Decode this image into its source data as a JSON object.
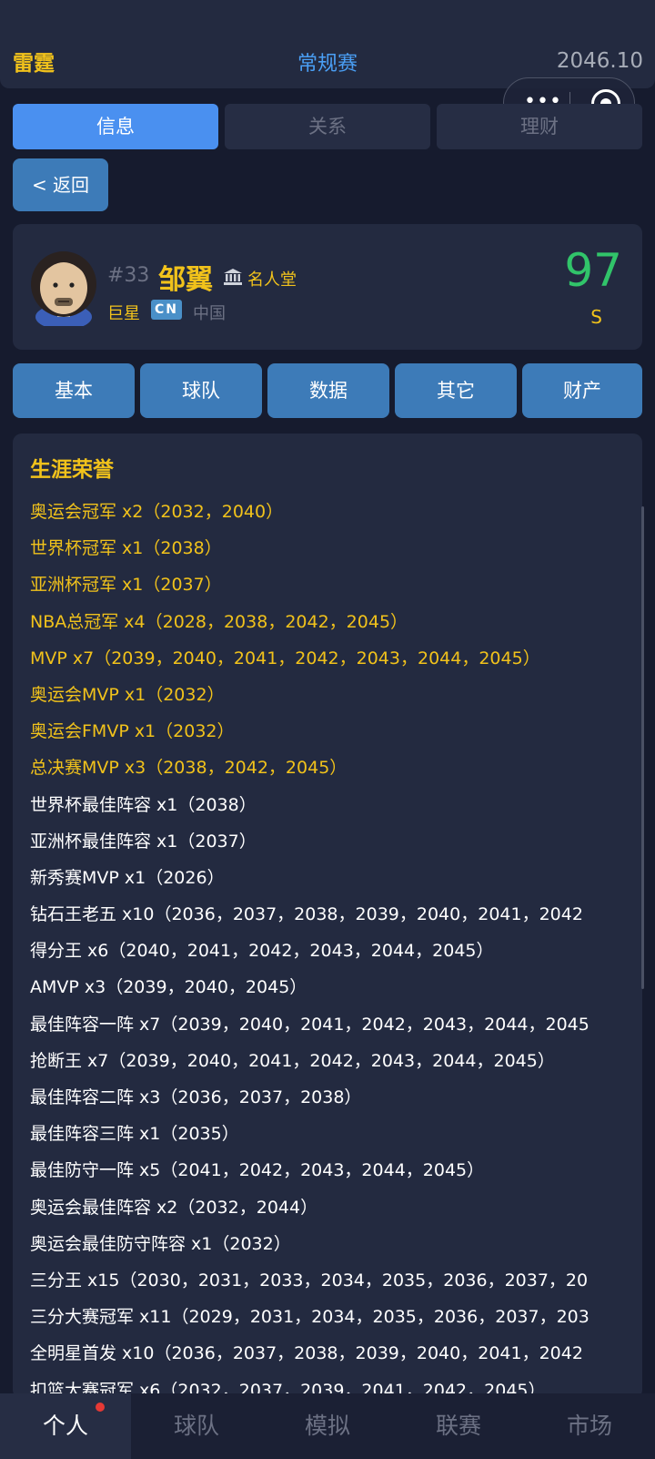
{
  "header": {
    "team": "雷霆",
    "season_type": "常规赛",
    "date": "2046.10"
  },
  "tabs": [
    {
      "label": "信息",
      "active": true
    },
    {
      "label": "关系",
      "active": false
    },
    {
      "label": "理财",
      "active": false
    }
  ],
  "back_label": "< 返回",
  "player": {
    "number": "#33",
    "name": "邹翼",
    "hall_label": "名人堂",
    "tier": "巨星",
    "flag": "CN",
    "country": "中国",
    "rating": "97",
    "grade": "S"
  },
  "subnav": [
    "基本",
    "球队",
    "数据",
    "其它",
    "财产"
  ],
  "honors": {
    "title": "生涯荣誉",
    "items": [
      {
        "text": "奥运会冠军 x2（2032，2040）",
        "gold": true
      },
      {
        "text": "世界杯冠军 x1（2038）",
        "gold": true
      },
      {
        "text": "亚洲杯冠军 x1（2037）",
        "gold": true
      },
      {
        "text": "NBA总冠军 x4（2028，2038，2042，2045）",
        "gold": true
      },
      {
        "text": "MVP x7（2039，2040，2041，2042，2043，2044，2045）",
        "gold": true
      },
      {
        "text": "奥运会MVP x1（2032）",
        "gold": true
      },
      {
        "text": "奥运会FMVP x1（2032）",
        "gold": true
      },
      {
        "text": "总决赛MVP x3（2038，2042，2045）",
        "gold": true
      },
      {
        "text": "世界杯最佳阵容 x1（2038）",
        "gold": false
      },
      {
        "text": "亚洲杯最佳阵容 x1（2037）",
        "gold": false
      },
      {
        "text": "新秀赛MVP x1（2026）",
        "gold": false
      },
      {
        "text": "钻石王老五 x10（2036，2037，2038，2039，2040，2041，2042",
        "gold": false
      },
      {
        "text": "得分王 x6（2040，2041，2042，2043，2044，2045）",
        "gold": false
      },
      {
        "text": "AMVP x3（2039，2040，2045）",
        "gold": false
      },
      {
        "text": "最佳阵容一阵 x7（2039，2040，2041，2042，2043，2044，2045",
        "gold": false
      },
      {
        "text": "抢断王 x7（2039，2040，2041，2042，2043，2044，2045）",
        "gold": false
      },
      {
        "text": "最佳阵容二阵 x3（2036，2037，2038）",
        "gold": false
      },
      {
        "text": "最佳阵容三阵 x1（2035）",
        "gold": false
      },
      {
        "text": "最佳防守一阵 x5（2041，2042，2043，2044，2045）",
        "gold": false
      },
      {
        "text": "奥运会最佳阵容 x2（2032，2044）",
        "gold": false
      },
      {
        "text": "奥运会最佳防守阵容 x1（2032）",
        "gold": false
      },
      {
        "text": "三分王 x15（2030，2031，2033，2034，2035，2036，2037，20",
        "gold": false
      },
      {
        "text": "三分大赛冠军 x11（2029，2031，2034，2035，2036，2037，203",
        "gold": false
      },
      {
        "text": "全明星首发 x10（2036，2037，2038，2039，2040，2041，2042",
        "gold": false
      },
      {
        "text": "扣篮大赛冠军 x6（2032，2037，2039，2041，2042，2045）",
        "gold": false
      }
    ]
  },
  "bottom_nav": [
    {
      "label": "个人",
      "active": true,
      "badge": true
    },
    {
      "label": "球队",
      "active": false
    },
    {
      "label": "模拟",
      "active": false
    },
    {
      "label": "联赛",
      "active": false
    },
    {
      "label": "市场",
      "active": false
    }
  ],
  "colors": {
    "background": "#161b2e",
    "panel": "#232a40",
    "accent_blue": "#4a90f0",
    "button_blue": "#3d7bb8",
    "gold": "#f1c21b",
    "rating_green": "#31c46a",
    "muted": "#6c7184"
  }
}
